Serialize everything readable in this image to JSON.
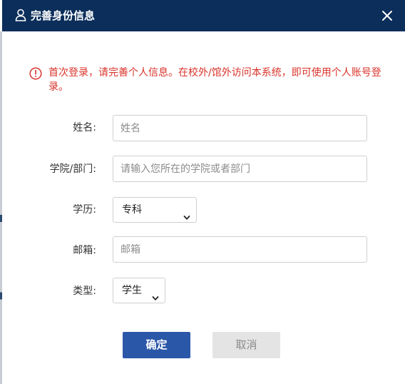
{
  "dialog": {
    "title": "完善身份信息",
    "header_color": "#0b2e5a"
  },
  "notice": {
    "text": "首次登录，请完善个人信息。在校外/馆外访问本系统，即可使用个人账号登录。",
    "color": "#d9332b"
  },
  "form": {
    "name_label": "姓名:",
    "name_placeholder": "姓名",
    "department_label": "学院/部门:",
    "department_placeholder": "请输入您所在的学院或者部门",
    "education_label": "学历:",
    "education_value": "专科",
    "email_label": "邮箱:",
    "email_placeholder": "邮箱",
    "type_label": "类型:",
    "type_value": "学生"
  },
  "buttons": {
    "confirm": "确定",
    "cancel": "取消",
    "primary_color": "#2b57a8"
  },
  "icons": {
    "title_icon": "user-icon",
    "close_icon": "close-icon",
    "warning_icon": "warning-circle-icon",
    "select_caret": "chevron-down-icon"
  }
}
